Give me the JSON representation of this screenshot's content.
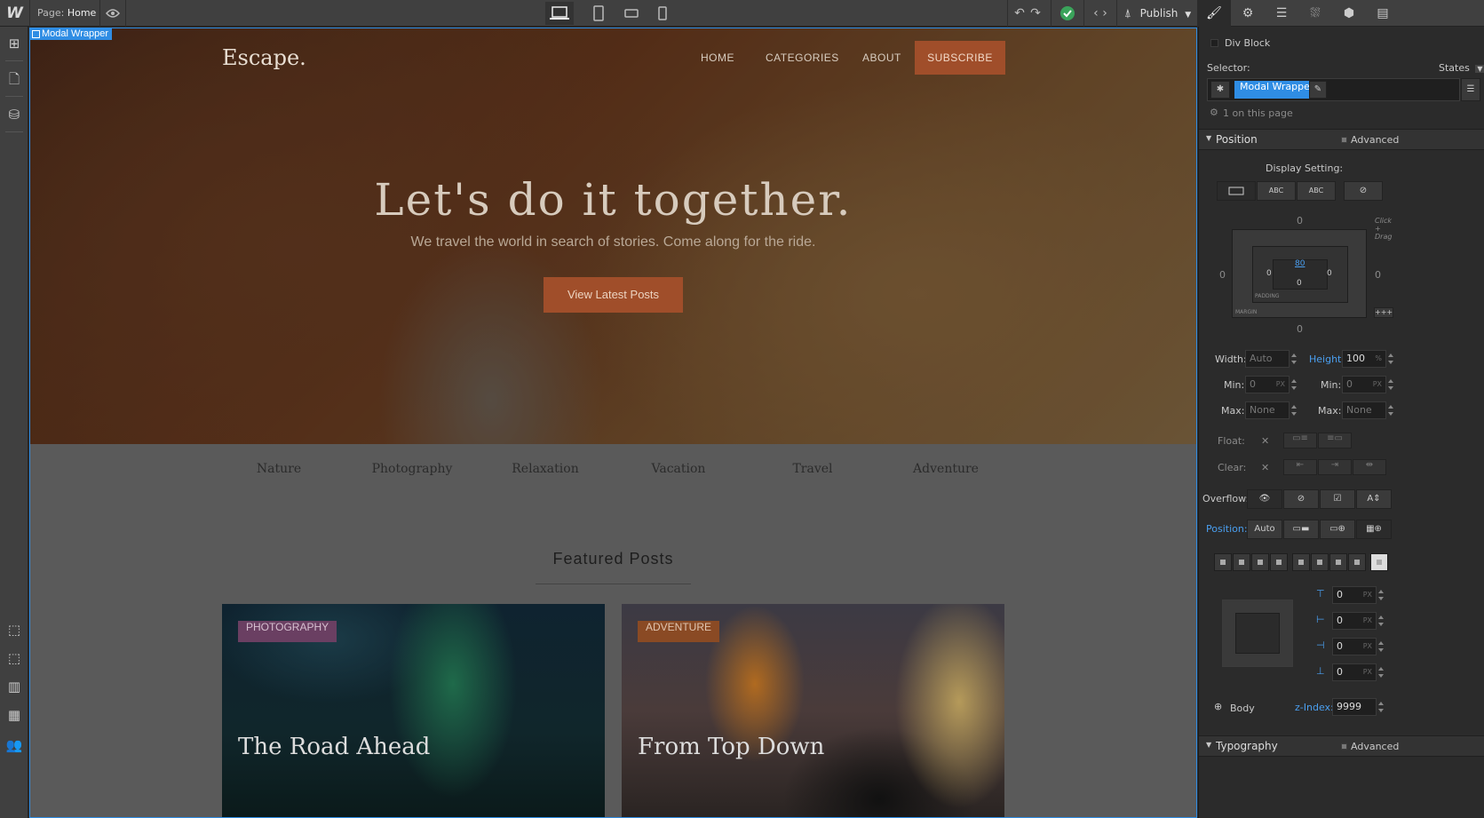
{
  "topbar": {
    "logo": "W",
    "page_prefix": "Page:",
    "page_name": "Home",
    "publish_label": "Publish"
  },
  "selection": {
    "label": "Modal Wrapper"
  },
  "site": {
    "brand": "Escape.",
    "nav": [
      "HOME",
      "CATEGORIES",
      "ABOUT"
    ],
    "subscribe": "SUBSCRIBE",
    "headline": "Let's do it together.",
    "subline": "We travel the world in search of stories. Come along for the ride.",
    "cta": "View Latest Posts",
    "categories": [
      "Nature",
      "Photography",
      "Relaxation",
      "Vacation",
      "Travel",
      "Adventure"
    ],
    "featured_title": "Featured Posts",
    "cards": [
      {
        "tag": "PHOTOGRAPHY",
        "title": "The Road Ahead"
      },
      {
        "tag": "ADVENTURE",
        "title": "From Top Down"
      }
    ]
  },
  "panel": {
    "element_type": "Div Block",
    "selector_label": "Selector:",
    "states_label": "States",
    "selector_chip": "Modal Wrapper",
    "on_page": "1 on this page",
    "position_section": "Position",
    "advanced_label": "Advanced",
    "display_setting": "Display Setting:",
    "display_inline_block": "ABC",
    "display_inline": "ABC",
    "margin_top": "0",
    "margin_left": "0",
    "margin_right": "0",
    "margin_bottom": "0",
    "padding_top": "80",
    "padding_left": "0",
    "padding_right": "0",
    "padding_bottom": "0",
    "padding_label": "PADDING",
    "margin_label": "MARGIN",
    "width_label": "Width:",
    "width_value": "Auto",
    "height_label": "Height:",
    "height_value": "100",
    "height_unit": "%",
    "min_label": "Min:",
    "min_width": "0",
    "min_height": "0",
    "max_label": "Max:",
    "max_width": "None",
    "max_height": "None",
    "px_unit": "PX",
    "float_label": "Float:",
    "clear_label": "Clear:",
    "overflow_label": "Overflow:",
    "position_label": "Position:",
    "position_value": "Auto",
    "offset_top": "0",
    "offset_left": "0",
    "offset_right": "0",
    "offset_bottom": "0",
    "relative_to": "Body",
    "zindex_label": "z-Index:",
    "zindex_value": "9999",
    "typography_section": "Typography",
    "click_drag_hint": "Click + Drag"
  }
}
